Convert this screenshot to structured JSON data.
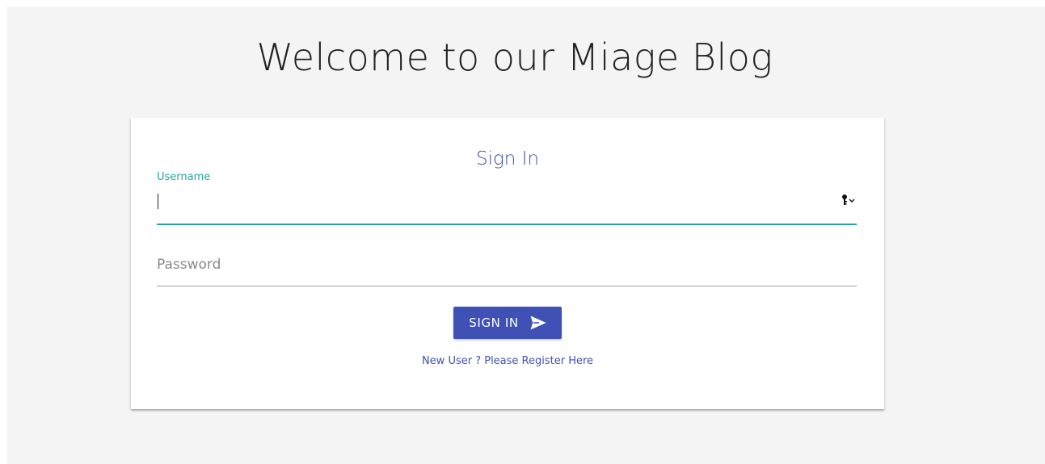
{
  "page": {
    "title": "Welcome to our Miage Blog"
  },
  "card": {
    "title": "Sign In",
    "username": {
      "label": "Username",
      "value": ""
    },
    "password": {
      "label": "Password",
      "value": ""
    },
    "signin_button": {
      "label": "SIGN IN",
      "icon": "send-icon"
    },
    "register_link": "New User ? Please Register Here",
    "password_manager_icon": "key-icon"
  },
  "colors": {
    "accent": "#3f51b5",
    "focus": "#26a69a",
    "background": "#f4f4f4"
  }
}
